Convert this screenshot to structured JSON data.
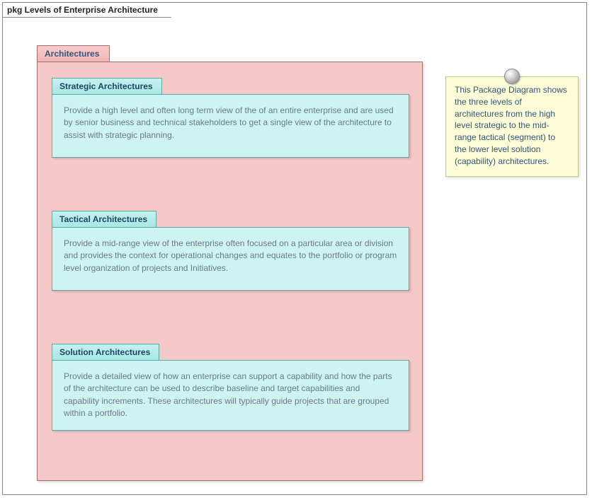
{
  "frame": {
    "title": "pkg Levels of Enterprise Architecture"
  },
  "outer_package": {
    "title": "Architectures"
  },
  "packages": [
    {
      "title": "Strategic Architectures",
      "body": "Provide a high level and often long term view of the of an entire enterprise and are used by senior business and technical stakeholders to get a single view of the architecture to assist with strategic planning."
    },
    {
      "title": "Tactical Architectures",
      "body": "Provide a mid-range view of the enterprise often focused on a particular area or division and provides the context for operational changes and equates to the portfolio or program level organization of projects and Initiatives."
    },
    {
      "title": "Solution Architectures",
      "body": "Provide a detailed view of how an enterprise can support a capability and how the parts of the architecture can be used to describe baseline and target capabilities and capability increments. These architectures will typically guide projects that are grouped within a portfolio."
    }
  ],
  "note": {
    "text": "This Package Diagram shows the three levels of architectures from the high level strategic to the mid-range tactical (segment) to the lower level solution (capability) architectures."
  }
}
